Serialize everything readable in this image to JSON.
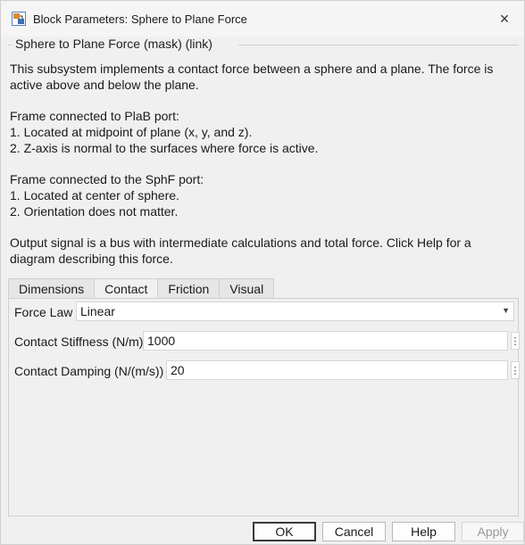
{
  "window": {
    "title": "Block Parameters: Sphere to Plane Force",
    "close_glyph": "×"
  },
  "group": {
    "title": "Sphere to Plane Force (mask) (link)"
  },
  "description": {
    "p1": "This subsystem implements a contact force between a sphere and a plane.  The force is active above and below the plane.",
    "p2_l1": "Frame connected to PlaB port:",
    "p2_l2": "1. Located at midpoint of plane (x, y, and z).",
    "p2_l3": "2. Z-axis is normal to the surfaces where force is active.",
    "p3_l1": "Frame connected to the SphF port:",
    "p3_l2": "1. Located at center of sphere.",
    "p3_l3": "2. Orientation does not matter.",
    "p4": "Output signal is a bus with intermediate calculations and total force. Click Help for a diagram describing this force."
  },
  "tabs": [
    {
      "label": "Dimensions"
    },
    {
      "label": "Contact"
    },
    {
      "label": "Friction"
    },
    {
      "label": "Visual"
    }
  ],
  "active_tab": "Contact",
  "params": {
    "force_law_label": "Force Law",
    "force_law_value": "Linear",
    "stiffness_label": "Contact Stiffness (N/m)",
    "stiffness_value": "1000",
    "damping_label": "Contact Damping (N/(m/s))",
    "damping_value": "20"
  },
  "buttons": {
    "ok": "OK",
    "cancel": "Cancel",
    "help": "Help",
    "apply": "Apply"
  }
}
